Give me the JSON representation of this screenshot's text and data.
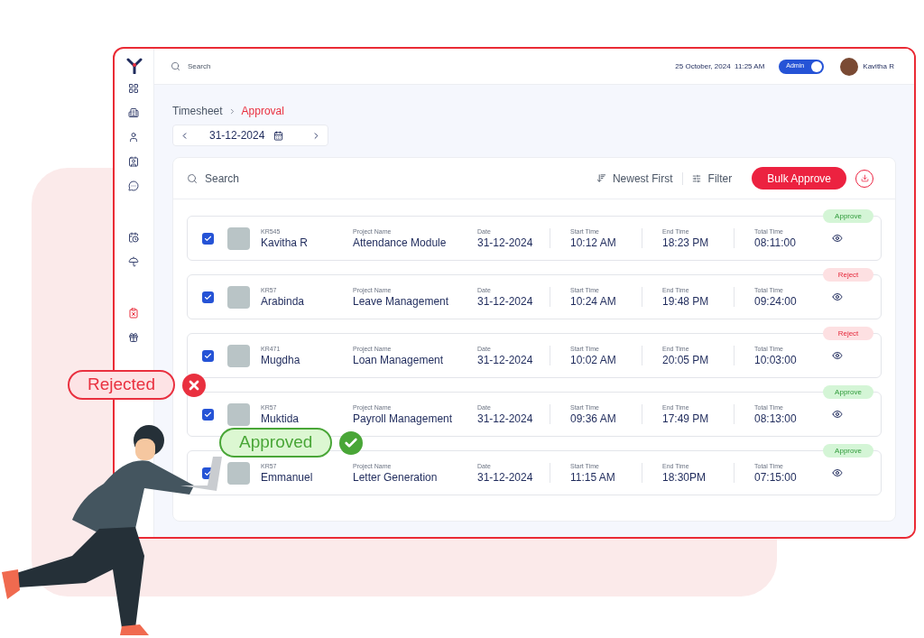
{
  "topbar": {
    "search": {
      "placeholder": "Search"
    },
    "datetime": "25 October, 2024  11:25 AM",
    "role_toggle": {
      "label": "Admin",
      "on": true
    },
    "user": {
      "name": "Kavitha R"
    }
  },
  "sidebar": {
    "items": [
      {
        "selected": false
      },
      {
        "selected": false
      },
      {
        "selected": false
      },
      {
        "selected": false
      },
      {
        "selected": false
      },
      {
        "selected": false
      },
      {
        "selected": false
      },
      {
        "selected": true
      },
      {
        "selected": false
      }
    ]
  },
  "breadcrumb": [
    {
      "label": "Timesheet",
      "selected": false
    },
    {
      "label": "Approval",
      "selected": true
    }
  ],
  "date_picker": {
    "value": "31-12-2024"
  },
  "toolbar": {
    "search": {
      "placeholder": "Search"
    },
    "sort": "Newest First",
    "filter": "Filter",
    "bulk_button": "Bulk Approve"
  },
  "rows": [
    {
      "checked": true,
      "id": "KR545",
      "name": "Kavitha R",
      "status": {
        "kind": "approve",
        "label": "Approve"
      },
      "fields": [
        {
          "label": "Project Name",
          "value": "Attendance Module"
        },
        {
          "label": "Date",
          "value": "31-12-2024"
        },
        {
          "label": "Start Time",
          "value": "10:12 AM"
        },
        {
          "label": "End Time",
          "value": "18:23 PM"
        },
        {
          "label": "Total Time",
          "value": "08:11:00"
        }
      ]
    },
    {
      "checked": true,
      "id": "KR57",
      "name": "Arabinda",
      "status": {
        "kind": "reject",
        "label": "Reject"
      },
      "fields": [
        {
          "label": "Project Name",
          "value": "Leave Management"
        },
        {
          "label": "Date",
          "value": "31-12-2024"
        },
        {
          "label": "Start Time",
          "value": "10:24 AM"
        },
        {
          "label": "End Time",
          "value": "19:48 PM"
        },
        {
          "label": "Total Time",
          "value": "09:24:00"
        }
      ]
    },
    {
      "checked": true,
      "id": "KR471",
      "name": "Mugdha",
      "status": {
        "kind": "reject",
        "label": "Reject"
      },
      "fields": [
        {
          "label": "Project Name",
          "value": "Loan Management"
        },
        {
          "label": "Date",
          "value": "31-12-2024"
        },
        {
          "label": "Start Time",
          "value": "10:02 AM"
        },
        {
          "label": "End Time",
          "value": "20:05 PM"
        },
        {
          "label": "Total Time",
          "value": "10:03:00"
        }
      ]
    },
    {
      "checked": true,
      "id": "KR57",
      "name": "Muktida",
      "status": {
        "kind": "approve",
        "label": "Approve"
      },
      "fields": [
        {
          "label": "Project Name",
          "value": "Payroll Management"
        },
        {
          "label": "Date",
          "value": "31-12-2024"
        },
        {
          "label": "Start Time",
          "value": "09:36 AM"
        },
        {
          "label": "End Time",
          "value": "17:49 PM"
        },
        {
          "label": "Total Time",
          "value": "08:13:00"
        }
      ]
    },
    {
      "checked": true,
      "id": "KR57",
      "name": "Emmanuel",
      "status": {
        "kind": "approve",
        "label": "Approve"
      },
      "fields": [
        {
          "label": "Project Name",
          "value": "Letter Generation"
        },
        {
          "label": "Date",
          "value": "31-12-2024"
        },
        {
          "label": "Start Time",
          "value": "11:15 AM"
        },
        {
          "label": "End Time",
          "value": "18:30PM"
        },
        {
          "label": "Total Time",
          "value": "07:15:00"
        }
      ]
    }
  ],
  "overlays": [
    {
      "kind": "rejected",
      "label": "Rejected"
    },
    {
      "kind": "approved",
      "label": "Approved"
    }
  ]
}
